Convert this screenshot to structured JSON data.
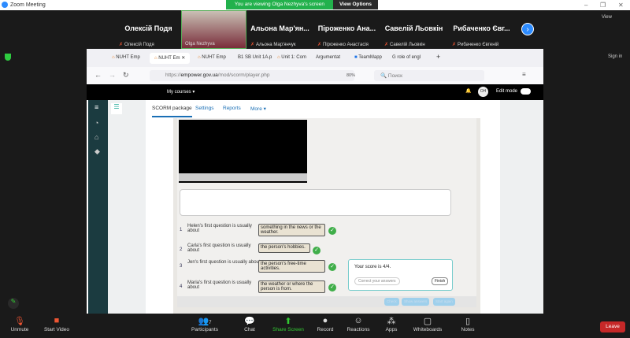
{
  "window": {
    "title": "Zoom Meeting",
    "banner": "You are viewing Olga Nezhyva's screen",
    "view_options": "View Options",
    "view": "View",
    "sign_in": "Sign in"
  },
  "participants": [
    {
      "big": "Олексій Подя",
      "small": "Олексій Подя"
    },
    {
      "big": "",
      "small": "Olga Nezhyva"
    },
    {
      "big": "Альона Мар'ян...",
      "small": "Альона Мар'янчук"
    },
    {
      "big": "Піроженко Ана...",
      "small": "Піроженко Анастасія"
    },
    {
      "big": "Савелій Льовкін",
      "small": "Савелій Льовкін"
    },
    {
      "big": "Рибаченко Євг...",
      "small": "Рибаченко Євгеній"
    }
  ],
  "browser": {
    "tabs": [
      "NUHT Emp",
      "NUHT Em",
      "NUHT Emp",
      "B1 SB Unit 1A.p",
      "Unit 1: Com",
      "Argumentat",
      "TeamMapp",
      "role of engl"
    ],
    "url_prefix": "https://",
    "url_domain": "empower.gov.ua",
    "url_path": "/mod/scorm/player.php",
    "zoom": "80%",
    "search": "Поиск"
  },
  "moodle": {
    "my_courses": "My courses ▾",
    "avatar": "OH",
    "edit_mode": "Edit mode",
    "nav": [
      "SCORM package",
      "Settings",
      "Reports",
      "More ▾"
    ]
  },
  "questions": [
    {
      "n": "1",
      "prompt": "Helen's first question is usually about",
      "answer": "something in the news or the weather."
    },
    {
      "n": "2",
      "prompt": "Carla's first question is usually about",
      "answer": "the person's hobbies."
    },
    {
      "n": "3",
      "prompt": "Jen's first question is usually about",
      "answer": "the person's free-time activities."
    },
    {
      "n": "4",
      "prompt": "Maria's first question is usually about",
      "answer": "the weather or where the person is from."
    }
  ],
  "score": {
    "text": "Your score is 4/4.",
    "correct": "Correct your answers",
    "finish": "Finish"
  },
  "footer_buttons": [
    "Check",
    "Show answers",
    "Start again"
  ],
  "toolbar": {
    "unmute": "Unmute",
    "video": "Start Video",
    "participants": "Participants",
    "count": "7",
    "chat": "Chat",
    "share": "Share Screen",
    "record": "Record",
    "reactions": "Reactions",
    "apps": "Apps",
    "whiteboards": "Whiteboards",
    "notes": "Notes",
    "leave": "Leave"
  }
}
